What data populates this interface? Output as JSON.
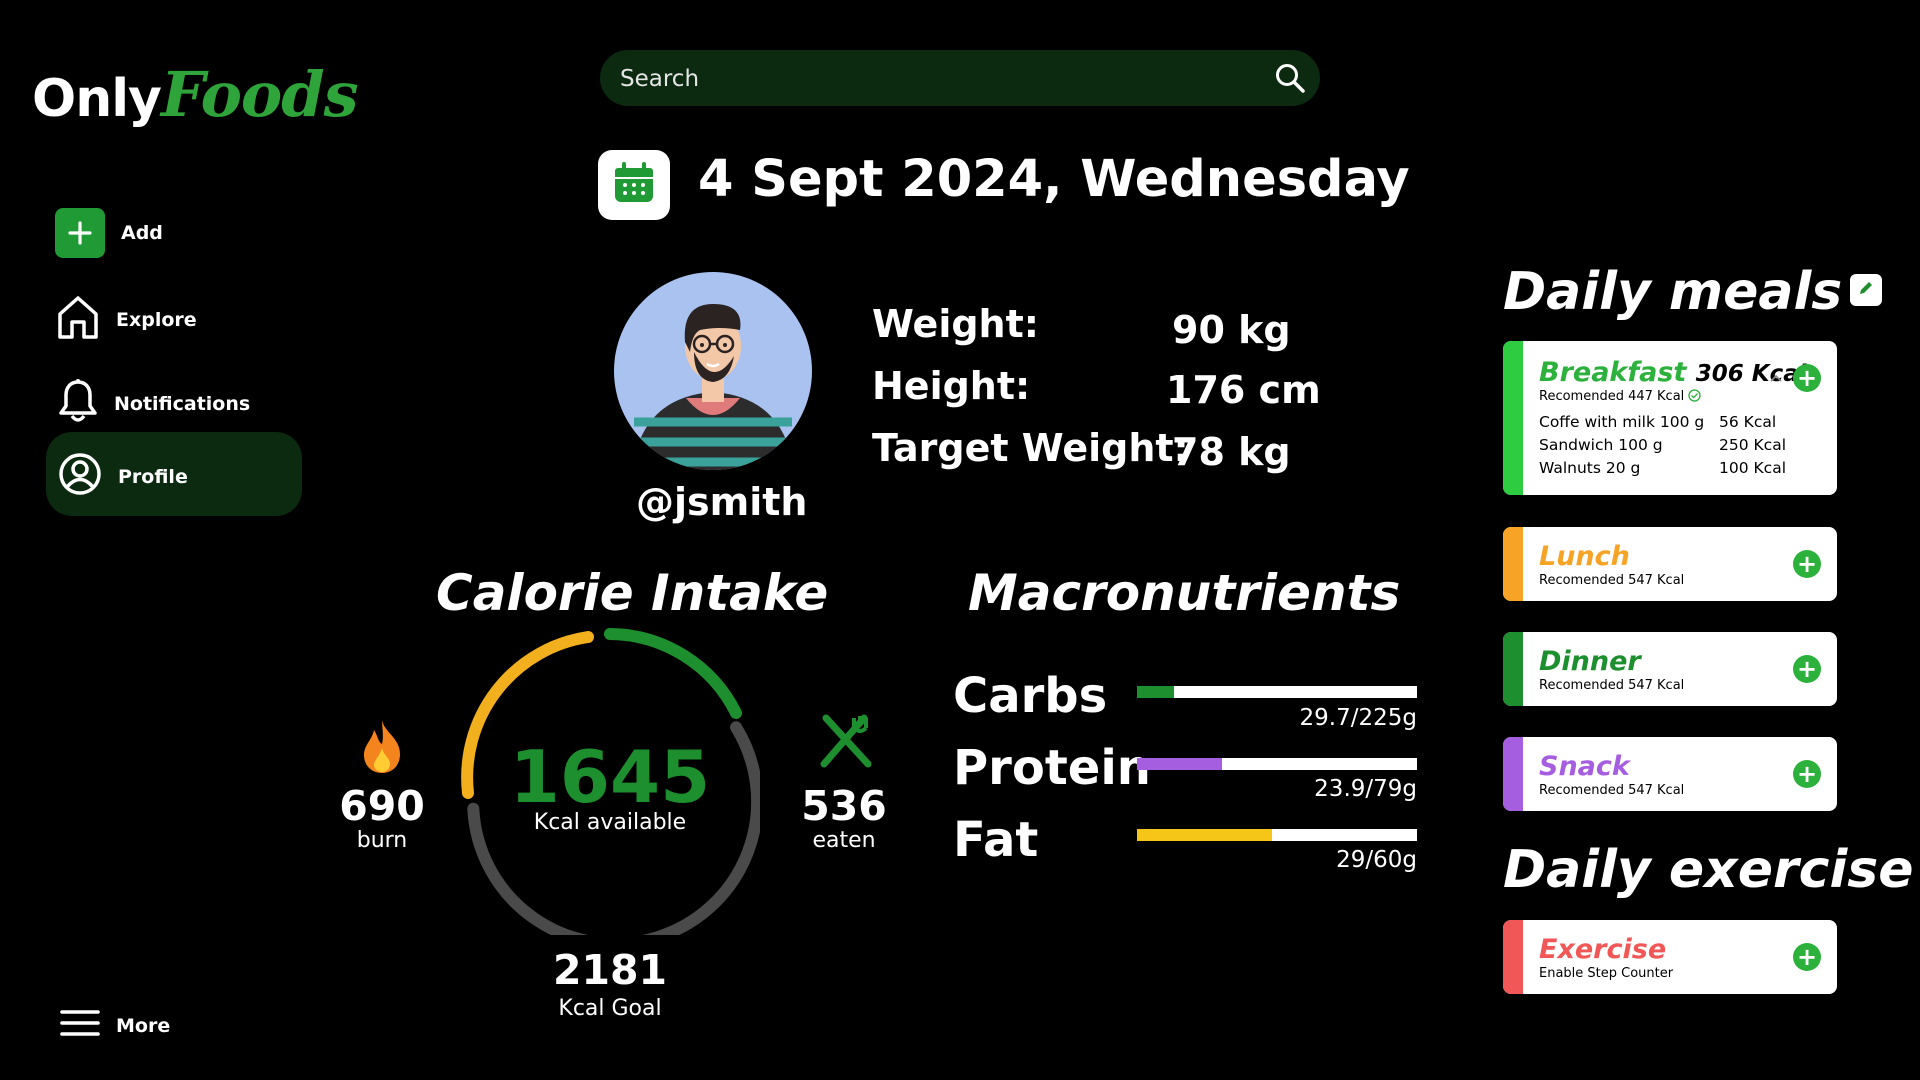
{
  "brand": {
    "part1": "Only",
    "part2": "Foods"
  },
  "colors": {
    "accent": "#2ea43a",
    "dark_green": "#0b2a10",
    "orange": "#f7a326",
    "purple": "#a55ee0",
    "red": "#f25757",
    "yellow": "#f5c518"
  },
  "sidebar": {
    "items": [
      {
        "label": "Add",
        "icon": "plus-icon"
      },
      {
        "label": "Explore",
        "icon": "home-icon"
      },
      {
        "label": "Notifications",
        "icon": "bell-icon"
      },
      {
        "label": "Profile",
        "icon": "user-icon",
        "active": true
      }
    ],
    "more_label": "More"
  },
  "search": {
    "placeholder": "Search"
  },
  "date": {
    "text": "4 Sept 2024, Wednesday"
  },
  "profile": {
    "username": "@jsmith",
    "stats": [
      {
        "label": "Weight:",
        "value": "90 kg"
      },
      {
        "label": "Height:",
        "value": "176 cm"
      },
      {
        "label": "Target Weight:",
        "value": "78 kg"
      }
    ]
  },
  "calorie": {
    "title": "Calorie Intake",
    "available": "1645",
    "available_label": "Kcal available",
    "burn": "690",
    "burn_label": "burn",
    "eaten": "536",
    "eaten_label": "eaten",
    "goal": "2181",
    "goal_label": "Kcal Goal"
  },
  "macros": {
    "title": "Macronutrients",
    "items": [
      {
        "name": "Carbs",
        "value": "29.7/225g",
        "fraction": 0.132,
        "color": "#1e8f2e"
      },
      {
        "name": "Protein",
        "value": "23.9/79g",
        "fraction": 0.302,
        "color": "#a55ee0"
      },
      {
        "name": "Fat",
        "value": "29/60g",
        "fraction": 0.483,
        "color": "#f5c518"
      }
    ]
  },
  "meals": {
    "title": "Daily meals",
    "breakfast": {
      "name": "Breakfast",
      "kcal": "306 Kcal",
      "recommended": "Recomended 447 Kcal",
      "foods": [
        {
          "name": "Coffe with milk 100 g",
          "kcal": "56 Kcal"
        },
        {
          "name": "Sandwich 100 g",
          "kcal": "250 Kcal"
        },
        {
          "name": "Walnuts 20 g",
          "kcal": "100 Kcal"
        }
      ]
    },
    "lunch": {
      "name": "Lunch",
      "recommended": "Recomended 547 Kcal"
    },
    "dinner": {
      "name": "Dinner",
      "recommended": "Recomended 547 Kcal"
    },
    "snack": {
      "name": "Snack",
      "recommended": "Recomended 547 Kcal"
    }
  },
  "exercise": {
    "title": "Daily exercise",
    "name": "Exercise",
    "sub": "Enable Step Counter"
  }
}
